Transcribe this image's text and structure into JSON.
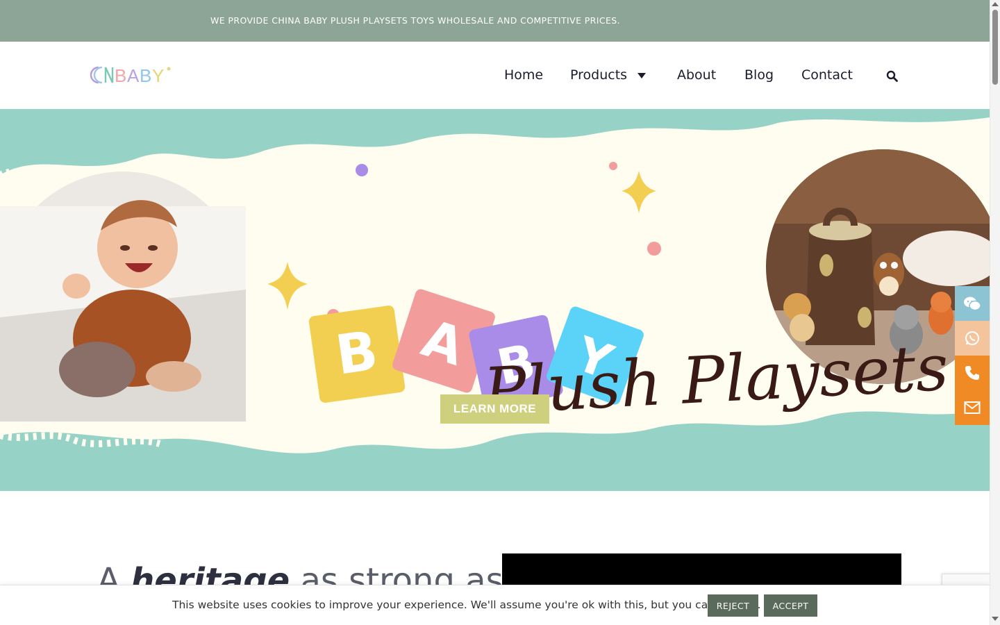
{
  "topbar": {
    "message": "WE PROVIDE CHINA BABY PLUSH PLAYSETS TOYS WHOLESALE AND COMPETITIVE PRICES."
  },
  "logo": {
    "text_c": "CN",
    "text_rest": "BABY",
    "icon": "cnbaby-logo"
  },
  "nav": {
    "home": "Home",
    "products": "Products",
    "about": "About",
    "blog": "Blog",
    "contact": "Contact",
    "search_icon": "search-icon"
  },
  "hero": {
    "blocks": [
      "B",
      "A",
      "B",
      "Y"
    ],
    "block_colors": [
      "#f2cf50",
      "#f29c9c",
      "#a98ce8",
      "#5bd3f8"
    ],
    "cta": "LEARN MORE",
    "script_title": "Plush Playsets",
    "colors": {
      "band": "#97d2c6",
      "paper": "#fffdf0",
      "cta": "#cfd07e",
      "script": "#3a1a14"
    }
  },
  "side_contacts": [
    {
      "icon": "wechat-icon",
      "color": "#8cc4d4"
    },
    {
      "icon": "whatsapp-icon",
      "color": "#f4c59d"
    },
    {
      "icon": "phone-icon",
      "color": "#f08a24"
    },
    {
      "icon": "email-icon",
      "color": "#f08a24"
    }
  ],
  "content": {
    "heading_pre": "A ",
    "heading_em": "heritage",
    "heading_post": " as strong as"
  },
  "cookie": {
    "text": "This website uses cookies to improve your experience. We'll assume you're ok with this, but you can opt-out.",
    "reject": "REJECT",
    "accept": "ACCEPT"
  }
}
